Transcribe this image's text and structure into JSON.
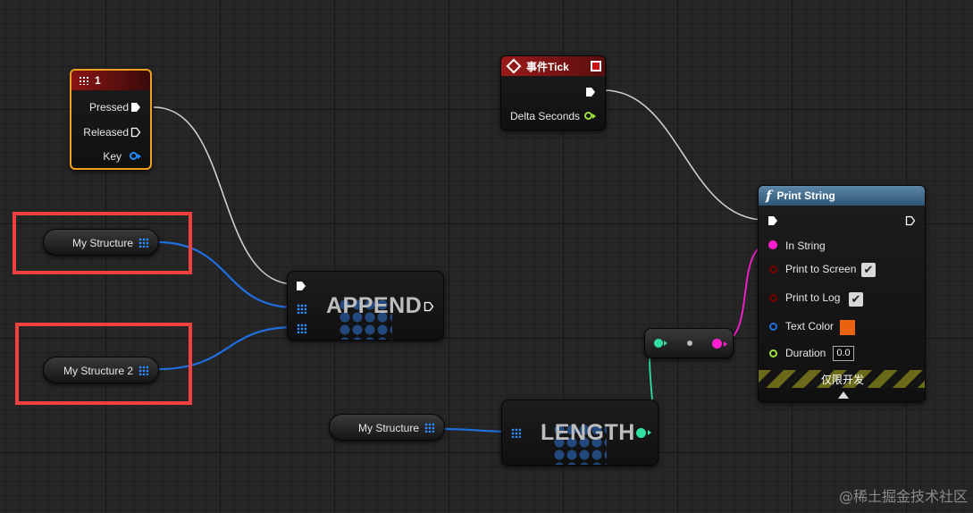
{
  "key_node": {
    "title": "1",
    "pins": [
      "Pressed",
      "Released",
      "Key"
    ]
  },
  "tick_node": {
    "title": "事件Tick",
    "pins": [
      "Delta Seconds"
    ]
  },
  "print_node": {
    "title": "Print String",
    "pins": [
      "In String",
      "Print to Screen",
      "Print to Log",
      "Text Color",
      "Duration"
    ],
    "duration_value": "0.0",
    "dev_only_label": "仅限开发",
    "text_color_hex": "#e8620f"
  },
  "append_node": {
    "title": "APPEND"
  },
  "length_node": {
    "title": "LENGTH"
  },
  "variables": [
    "My Structure",
    "My Structure 2",
    "My Structure"
  ],
  "watermark": "@稀土掘金技术社区",
  "colors": {
    "exec": "#ffffff",
    "struct": "#1f6fe0",
    "string": "#ff1fd0",
    "int": "#2fe0a0",
    "float": "#9be23c",
    "bool": "#a00000",
    "highlight": "#f23f3f"
  }
}
